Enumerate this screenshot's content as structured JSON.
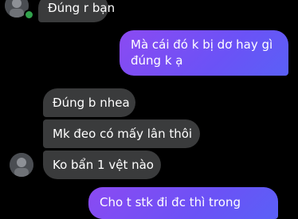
{
  "messages": [
    {
      "direction": "received",
      "text": "Đúng r bạn"
    },
    {
      "direction": "sent",
      "text": "Mà cái đó k bị dơ hay gì đúng k ạ"
    },
    {
      "direction": "received",
      "text": "Đúng b nhea"
    },
    {
      "direction": "received",
      "text": "Mk đeo có mấy lân thôi"
    },
    {
      "direction": "received",
      "text": "Ko bẩn 1 vệt nào"
    },
    {
      "direction": "sent",
      "text": "Cho t stk đi đc thì trong"
    }
  ],
  "colors": {
    "background": "#000000",
    "received_bubble": "#3a3b3c",
    "sent_bubble_start": "#8b4af2",
    "sent_bubble_end": "#5a60f7",
    "online_indicator": "#31a24c"
  },
  "icons": [
    "contact-avatar",
    "online-status-dot"
  ]
}
